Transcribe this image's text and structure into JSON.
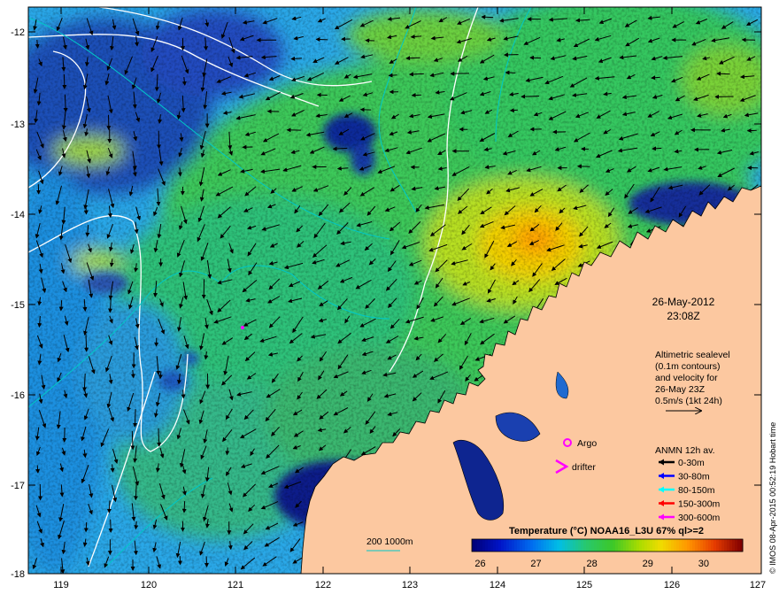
{
  "map": {
    "lon_ticks": [
      "119",
      "120",
      "121",
      "122",
      "123",
      "124",
      "125",
      "126",
      "127"
    ],
    "lat_ticks": [
      "-12",
      "-13",
      "-14",
      "-15",
      "-16",
      "-17",
      "-18"
    ],
    "lon_range": [
      118.6,
      127.0
    ],
    "lat_range": [
      -18.0,
      -11.72
    ]
  },
  "date": {
    "day": "26-May-2012",
    "time": "23:08Z"
  },
  "altimetry": {
    "lines": [
      "Altimetric sealevel",
      "(0.1m contours)",
      "and velocity for",
      "26-May 23Z",
      "0.5m/s (1kt 24h)"
    ]
  },
  "legend": {
    "argo": "Argo",
    "drifter": "drifter",
    "anmn_title": "ANMN 12h av.",
    "anmn": [
      {
        "label": "0-30m",
        "color": "#000000"
      },
      {
        "label": "30-80m",
        "color": "#0000ff"
      },
      {
        "label": "80-150m",
        "color": "#00ffff"
      },
      {
        "label": "150-300m",
        "color": "#ff0000"
      },
      {
        "label": "300-600m",
        "color": "#ff00ff"
      }
    ]
  },
  "isobath": {
    "label": "200  1000m",
    "color": "#00c8c8"
  },
  "colorbar": {
    "title": "Temperature (°C) NOAA16_L3U 67% ql>=2",
    "ticks": [
      "26",
      "27",
      "28",
      "29",
      "30"
    ],
    "range": [
      25.85,
      30.7
    ]
  },
  "credit": "© IMOS 08-Apr-2015 00:52:19 Hobart time",
  "colors": {
    "land": "#fcc8a0",
    "argo": "#ff00ff",
    "drifter": "#ff00ff"
  }
}
